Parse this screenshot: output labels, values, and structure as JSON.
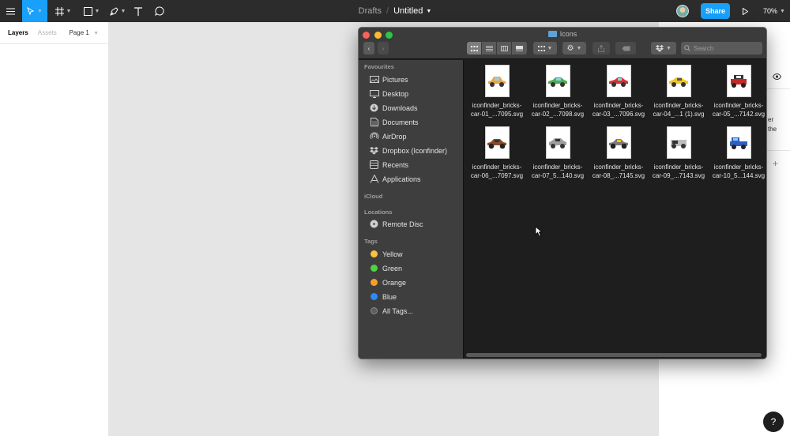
{
  "toolbar": {
    "breadcrumb_drafts": "Drafts",
    "breadcrumb_sep": "/",
    "title": "Untitled",
    "share_label": "Share",
    "zoom": "70%",
    "accent": "#18a0fb"
  },
  "left_panel": {
    "tab_layers": "Layers",
    "tab_assets": "Assets",
    "page": "Page 1"
  },
  "right_panel": {
    "text_line1": "er",
    "text_line2": "the"
  },
  "help_label": "?",
  "finder": {
    "title": "Icons",
    "search_placeholder": "Search",
    "sections": {
      "favourites": "Favourites",
      "icloud": "iCloud",
      "locations": "Locations",
      "tags": "Tags"
    },
    "favourites": [
      {
        "label": "Pictures",
        "icon": "pictures-icon"
      },
      {
        "label": "Desktop",
        "icon": "desktop-icon"
      },
      {
        "label": "Downloads",
        "icon": "downloads-icon"
      },
      {
        "label": "Documents",
        "icon": "documents-icon"
      },
      {
        "label": "AirDrop",
        "icon": "airdrop-icon"
      },
      {
        "label": "Dropbox (Iconfinder)",
        "icon": "dropbox-icon"
      },
      {
        "label": "Recents",
        "icon": "recents-icon"
      },
      {
        "label": "Applications",
        "icon": "applications-icon"
      }
    ],
    "locations": [
      {
        "label": "Remote Disc",
        "icon": "disc-icon"
      }
    ],
    "tags": [
      {
        "label": "Yellow",
        "color": "#f6c43d"
      },
      {
        "label": "Green",
        "color": "#4cd443"
      },
      {
        "label": "Orange",
        "color": "#f59e2e"
      },
      {
        "label": "Blue",
        "color": "#2f88f5"
      },
      {
        "label": "All Tags...",
        "color": "#6a6a6a"
      }
    ],
    "files": [
      {
        "line1": "iconfinder_bricks-",
        "line2": "car-01_...7095.svg",
        "color": "#f2a33a"
      },
      {
        "line1": "iconfinder_bricks-",
        "line2": "car-02_...7098.svg",
        "color": "#4caf50"
      },
      {
        "line1": "iconfinder_bricks-",
        "line2": "car-03_...7096.svg",
        "color": "#d9342b"
      },
      {
        "line1": "iconfinder_bricks-",
        "line2": "car-04_...1 (1).svg",
        "color": "#f5c518"
      },
      {
        "line1": "iconfinder_bricks-",
        "line2": "car-05_...7142.svg",
        "color": "#c62828"
      },
      {
        "line1": "iconfinder_bricks-",
        "line2": "car-06_...7097.svg",
        "color": "#8a4b2a"
      },
      {
        "line1": "iconfinder_bricks-",
        "line2": "car-07_5...140.svg",
        "color": "#9e9e9e"
      },
      {
        "line1": "iconfinder_bricks-",
        "line2": "car-08_...7145.svg",
        "color": "#7a7a7a"
      },
      {
        "line1": "iconfinder_bricks-",
        "line2": "car-09_...7143.svg",
        "color": "#bdbdbd"
      },
      {
        "line1": "iconfinder_bricks-",
        "line2": "car-10_5...144.svg",
        "color": "#2f5fbf"
      }
    ]
  }
}
